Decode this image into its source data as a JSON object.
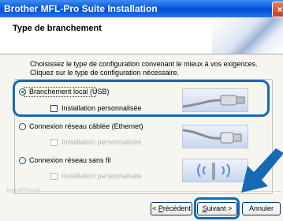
{
  "window": {
    "title": "Brother MFL-Pro Suite Installation",
    "close_symbol": "×"
  },
  "header": {
    "title": "Type de branchement"
  },
  "description": {
    "line1": "Choisissez le type de configuration convenant le mieux à vos exigences.",
    "line2": "Cliquez sur le type de configuration nécessaire."
  },
  "options": [
    {
      "label": "Branchement local (USB)",
      "selected": true,
      "custom_label": "Installation personnalisée",
      "custom_enabled": true
    },
    {
      "label": "Connexion réseau câblée (Ethernet)",
      "selected": false,
      "custom_label": "Installation personnalisée",
      "custom_enabled": false
    },
    {
      "label": "Connexion réseau sans fil",
      "selected": false,
      "custom_label": "Installation personnalisée",
      "custom_enabled": false
    }
  ],
  "footer": {
    "brand": "InstallShield"
  },
  "buttons": {
    "back": {
      "underline": "P",
      "rest": "récédent"
    },
    "next": {
      "underline": "S",
      "rest": "uivant >"
    },
    "cancel": "Annuler"
  },
  "colors": {
    "accent": "#1569b5",
    "titlebar": "#0a5ae0"
  },
  "icons": [
    "usb-cable-icon",
    "ethernet-cable-icon",
    "wireless-access-point-icon",
    "pointer-arrow-icon"
  ]
}
